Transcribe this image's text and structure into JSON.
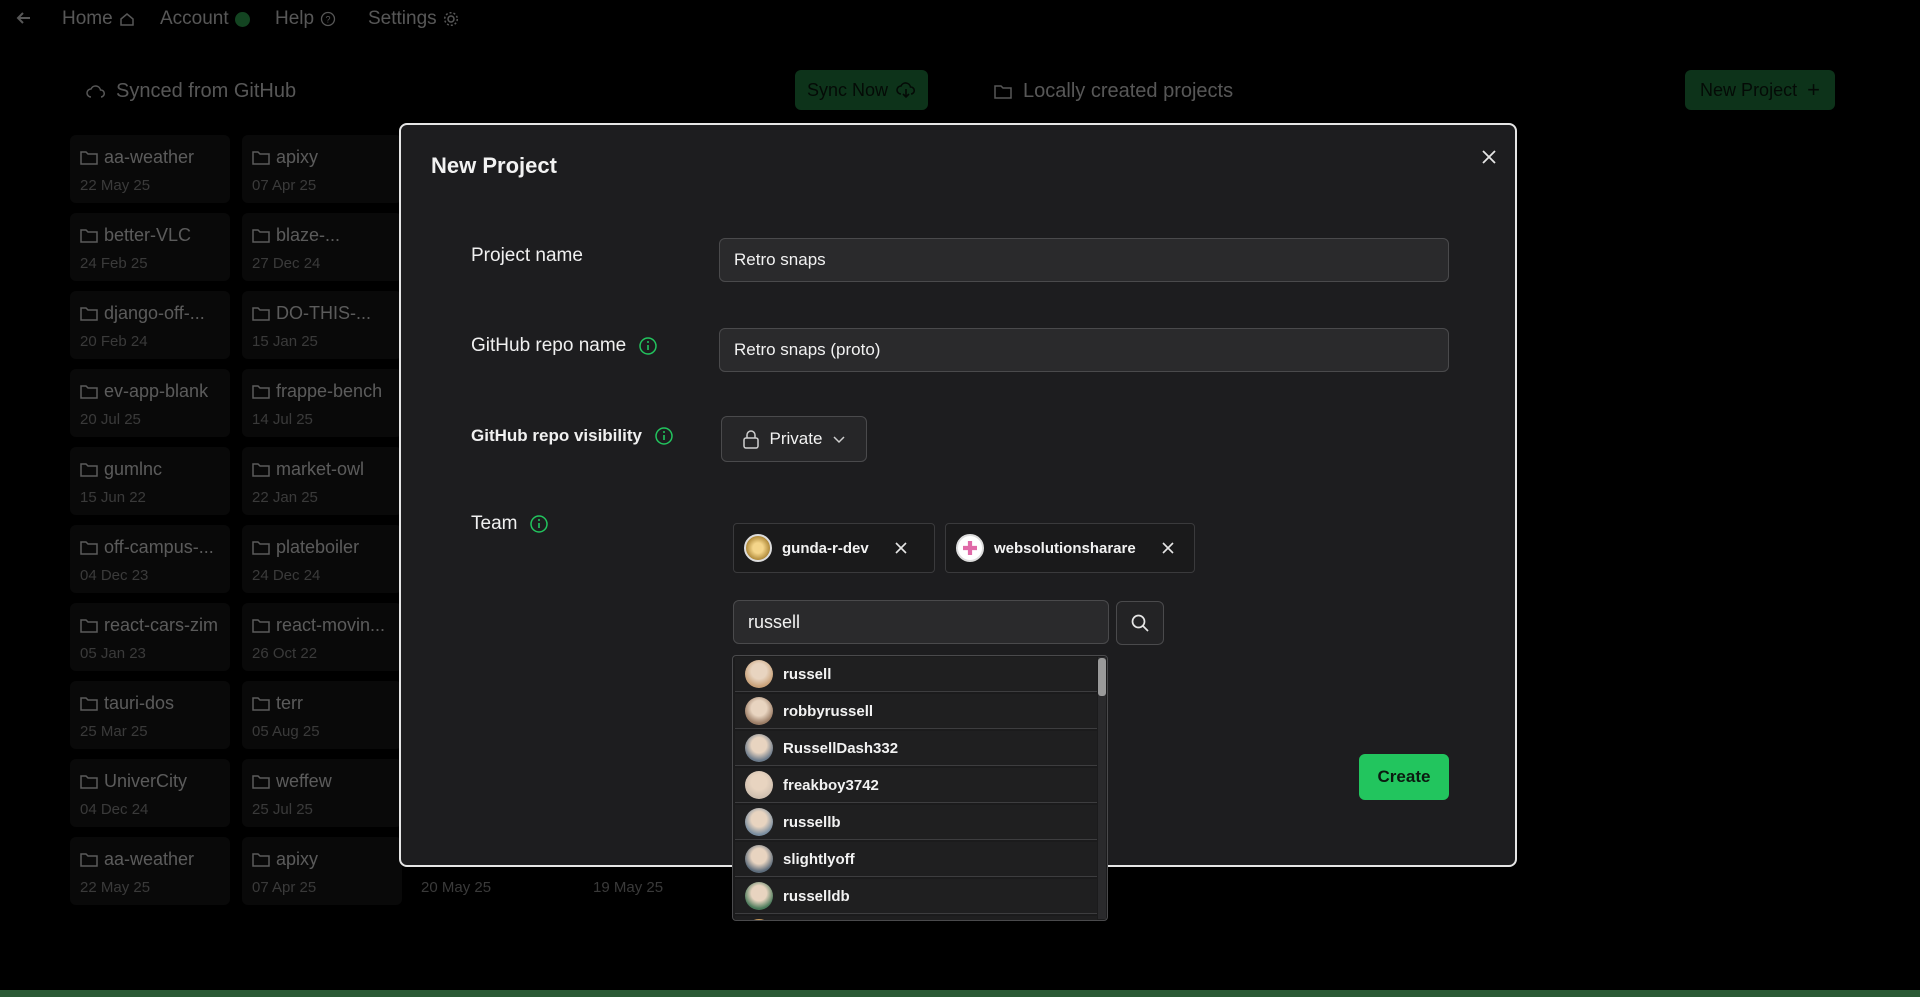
{
  "nav": {
    "home": "Home",
    "account": "Account",
    "help": "Help",
    "settings": "Settings"
  },
  "toolbar": {
    "synced_label": "Synced from GitHub",
    "sync_now": "Sync Now",
    "local_label": "Locally created projects",
    "new_project": "New Project"
  },
  "projects": [
    {
      "name": "aa-weather",
      "date": "22 May 25"
    },
    {
      "name": "apixy",
      "date": "07 Apr 25"
    },
    {
      "name": "better-VLC",
      "date": "24 Feb 25"
    },
    {
      "name": "blaze-...",
      "date": "27 Dec 24"
    },
    {
      "name": "django-off-...",
      "date": "20 Feb 24"
    },
    {
      "name": "DO-THIS-...",
      "date": "15 Jan 25"
    },
    {
      "name": "ev-app-blank",
      "date": "20 Jul 25"
    },
    {
      "name": "frappe-bench",
      "date": "14 Jul 25"
    },
    {
      "name": "gumlnc",
      "date": "15 Jun 22"
    },
    {
      "name": "market-owl",
      "date": "22 Jan 25"
    },
    {
      "name": "off-campus-...",
      "date": "04 Dec 23"
    },
    {
      "name": "plateboiler",
      "date": "24 Dec 24"
    },
    {
      "name": "react-cars-zim",
      "date": "05 Jan 23"
    },
    {
      "name": "react-movin...",
      "date": "26 Oct 22"
    },
    {
      "name": "tauri-dos",
      "date": "25 Mar 25"
    },
    {
      "name": "terr",
      "date": "05 Aug 25"
    },
    {
      "name": "UniverCity",
      "date": "04 Dec 24"
    },
    {
      "name": "weffew",
      "date": "25 Jul 25"
    },
    {
      "name": "aa-weather",
      "date": "22 May 25"
    },
    {
      "name": "apixy",
      "date": "07 Apr 25"
    }
  ],
  "extra_dates": [
    "20 May 25",
    "19 May 25"
  ],
  "modal": {
    "title": "New Project",
    "project_name_label": "Project name",
    "project_name_value": "Retro snaps",
    "repo_name_label": "GitHub repo name",
    "repo_name_value": "Retro snaps (proto)",
    "visibility_label": "GitHub repo visibility",
    "visibility_value": "Private",
    "team_label": "Team",
    "team_members": [
      "gunda-r-dev",
      "websolutionsharare"
    ],
    "search_value": "russell",
    "create_label": "Create"
  },
  "search_results": [
    "russell",
    "robbyrussell",
    "RussellDash332",
    "freakboy3742",
    "russellb",
    "slightlyoff",
    "russelldb"
  ],
  "colors": {
    "accent": "#22c55e",
    "accent_dim": "#1f7a3e",
    "modal_bg": "#1d1d1f"
  }
}
